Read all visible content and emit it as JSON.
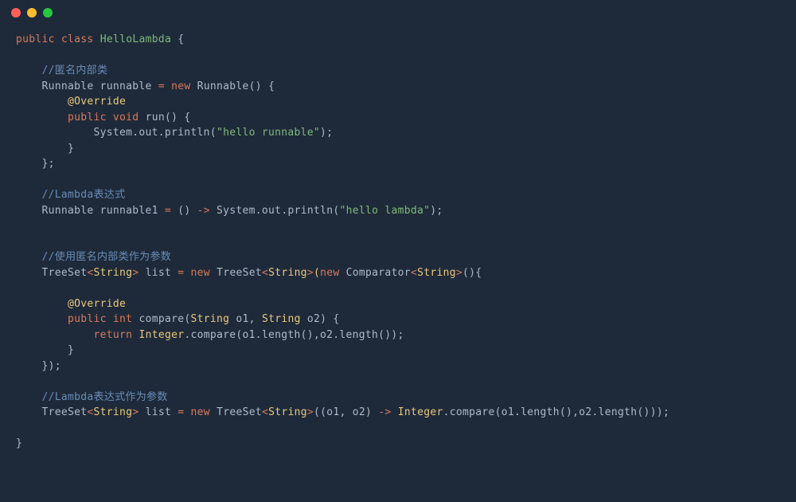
{
  "window": {
    "buttons": [
      "close",
      "minimize",
      "zoom"
    ]
  },
  "tokens": {
    "public": "public",
    "class": "class",
    "className": "HelloLambda",
    "lbrace": "{",
    "rbrace": "}",
    "rbraceSemi": "};",
    "rbraceParenSemi": "});",
    "cmt_anon": "//匿名内部类",
    "cmt_lambda": "//Lambda表达式",
    "cmt_anon_param": "//使用匿名内部类作为参数",
    "cmt_lambda_param": "//Lambda表达式作为参数",
    "Runnable": "Runnable",
    "runnable": "runnable",
    "runnable1": "runnable1",
    "eq": "=",
    "new": "new",
    "RunnableCall": "Runnable()",
    "Override": "@Override",
    "void": "void",
    "run": "run()",
    "Sysout": "System.out.println(",
    "str_hello_runnable": "\"hello runnable\"",
    "str_hello_lambda": "\"hello lambda\"",
    "closeCallSemi": ");",
    "arrow": "->",
    "emptyParens": "()",
    "TreeSet": "TreeSet",
    "lt": "<",
    "gt": ">",
    "String": "String",
    "list": "list",
    "Comparator": "Comparator",
    "lparen": "(",
    "rparen": ")",
    "int": "int",
    "compare": "compare",
    "o1": "o1",
    "o2": "o2",
    "comma": ",",
    "return": "return",
    "Integer": "Integer",
    "dotCompare": ".compare(",
    "o1len": "o1.length()",
    "o2len": "o2.length()",
    "o1o2": "(o1, o2)",
    "semicolon": ";",
    "space": " "
  }
}
